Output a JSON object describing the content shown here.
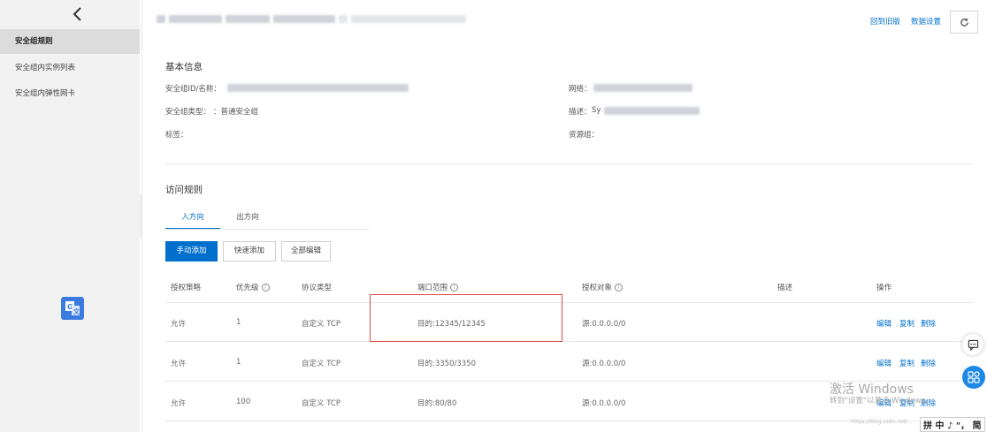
{
  "sidebar": {
    "items": [
      {
        "label": "安全组规则"
      },
      {
        "label": "安全组内实例列表"
      },
      {
        "label": "安全组内弹性网卡"
      }
    ]
  },
  "header": {
    "back_to_old": "回到旧版",
    "data_settings": "数据设置"
  },
  "basic_info": {
    "title": "基本信息",
    "id_name_label": "安全组ID/名称：",
    "type_label": "安全组类型：",
    "type_value": "：普通安全组",
    "tag_label": "标签：",
    "network_label": "网络：",
    "desc_label": "描述：",
    "desc_prefix": "Sy",
    "resource_group_label": "资源组："
  },
  "access_rules": {
    "title": "访问规则",
    "tabs": [
      {
        "label": "入方向"
      },
      {
        "label": "出方向"
      }
    ],
    "buttons": {
      "manual_add": "手动添加",
      "quick_add": "快速添加",
      "edit_all": "全部编辑"
    },
    "columns": [
      "授权策略",
      "优先级",
      "协议类型",
      "端口范围",
      "授权对象",
      "描述",
      "操作"
    ],
    "rows": [
      {
        "policy": "允许",
        "priority": "1",
        "protocol": "自定义 TCP",
        "port": "目的:12345/12345",
        "source": "源:0.0.0.0/0",
        "desc": ""
      },
      {
        "policy": "允许",
        "priority": "1",
        "protocol": "自定义 TCP",
        "port": "目的:3350/3350",
        "source": "源:0.0.0.0/0",
        "desc": ""
      },
      {
        "policy": "允许",
        "priority": "100",
        "protocol": "自定义 TCP",
        "port": "目的:80/80",
        "source": "源:0.0.0.0/0",
        "desc": ""
      }
    ],
    "ops": {
      "edit": "编辑",
      "copy": "复制",
      "delete": "删除"
    }
  },
  "watermark": {
    "title": "激活 Windows",
    "subtitle": "转到\"设置\"以激活 Windows。",
    "url": "https://blog.csdn.net/..."
  },
  "ime": {
    "label": "拼 中 ♪ \"， 简"
  }
}
